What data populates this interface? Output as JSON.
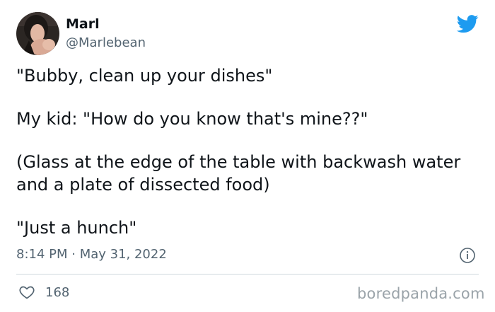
{
  "author": {
    "display_name": "Marl",
    "handle": "@Marlebean",
    "avatar_icon": "profile-photo"
  },
  "platform_icon": "twitter-bird-icon",
  "accent_color": "#1d9bf0",
  "tweet": {
    "paragraphs": [
      "\"Bubby, clean up your dishes\"",
      "My kid: \"How do you know that's mine??\"",
      "(Glass at the edge of the table with backwash water and a plate of dissected food)",
      "\"Just a hunch\""
    ],
    "timestamp": "8:14 PM · May 31, 2022"
  },
  "engagement": {
    "likes": "168"
  },
  "watermark": "boredpanda.com"
}
